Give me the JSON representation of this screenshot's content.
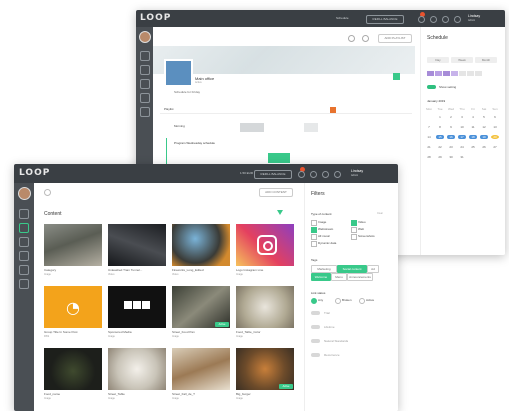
{
  "back_window": {
    "logo": "LOOP",
    "topbar": {
      "schedule_label": "Schedule",
      "balance_btn": "REFILL BALANCE",
      "user_name": "Lindsay",
      "user_sub": "Admin"
    },
    "playlist": {
      "title": "Main office",
      "sub": "Active",
      "schedule_line": "Schedule for Friday",
      "add_btn": "ADD PLAYLIST"
    },
    "timeline": {
      "row1": "Playlist",
      "row2": "Morning",
      "row3": "Program Wednesday schedule"
    },
    "schedule_panel": {
      "title": "Schedule",
      "tabs": [
        "Day",
        "Week",
        "Month"
      ],
      "toggle_label": "Show setting",
      "month_label": "January 2019",
      "weekdays": [
        "Mon",
        "Tue",
        "Wed",
        "Thu",
        "Fri",
        "Sat",
        "Sun"
      ],
      "weeks": [
        [
          "",
          "1",
          "2",
          "3",
          "4",
          "5",
          "6"
        ],
        [
          "7",
          "8",
          "9",
          "10",
          "11",
          "12",
          "13"
        ],
        [
          "14",
          "15",
          "16",
          "17",
          "18",
          "19",
          "20"
        ],
        [
          "21",
          "22",
          "23",
          "24",
          "25",
          "26",
          "27"
        ],
        [
          "28",
          "29",
          "30",
          "31",
          "",
          "",
          ""
        ]
      ]
    }
  },
  "front_window": {
    "logo": "LOOP",
    "topbar": {
      "balance_label": "1.50 EUR",
      "balance_btn": "REFILL BALANCE",
      "user_name": "Lindsay",
      "user_sub": "Admin"
    },
    "toolbar": {
      "add_btn": "ADD CONTENT",
      "search_placeholder": ""
    },
    "content_title": "Content",
    "items": [
      {
        "name": "Category",
        "sub": "Image"
      },
      {
        "name": "Unleashed Tram Tunnel...",
        "sub": "Video"
      },
      {
        "name": "Fireworks_Long_Edited",
        "sub": "Video"
      },
      {
        "name": "Logo Instagram Line",
        "sub": "Image"
      },
      {
        "name": "Group Title In Some Post",
        "sub": "RSS"
      },
      {
        "name": "Sponsored Media",
        "sub": "Image"
      },
      {
        "name": "Street_Food Pan",
        "sub": "Image",
        "badge": "Active"
      },
      {
        "name": "Food_Table_Color",
        "sub": "Image"
      },
      {
        "name": "Food_name",
        "sub": "Image"
      },
      {
        "name": "Street_Table",
        "sub": "Image"
      },
      {
        "name": "Street_Fall_de_T",
        "sub": "Image"
      },
      {
        "name": "Big_burger",
        "sub": "Image",
        "badge": "Active"
      }
    ],
    "filters": {
      "title": "Filters",
      "type_heading": "Type of content",
      "types": [
        "Image",
        "Video",
        "Webstream",
        "Web",
        "All music",
        "Screenshots",
        "Dynamic data"
      ],
      "tags_heading": "Tags",
      "tags": [
        "Marketing",
        "Social content",
        "Ad",
        "Welcome",
        "Menu",
        "Announcements"
      ],
      "link_heading": "Link status",
      "link_options": [
        "Any",
        "Broken",
        "Active"
      ],
      "toggles": [
        "Trial",
        "Lifetime",
        "Natural Standards",
        "Recurrence"
      ],
      "clear_label": "Clear"
    }
  },
  "colors": {
    "topbar": "#3a3f44",
    "sidebar": "#4a4f54",
    "accent": "#39c98a",
    "alert": "#e8532e",
    "purple": "#a78cd8"
  }
}
